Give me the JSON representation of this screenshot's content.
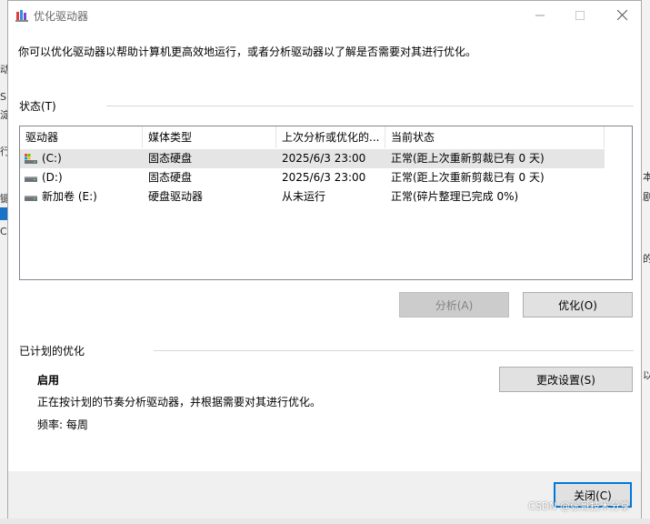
{
  "window": {
    "title": "优化驱动器"
  },
  "description": "你可以优化驱动器以帮助计算机更高效地运行，或者分析驱动器以了解是否需要对其进行优化。",
  "status": {
    "label": "状态(T)"
  },
  "table": {
    "columns": [
      "驱动器",
      "媒体类型",
      "上次分析或优化的...",
      "当前状态"
    ],
    "rows": [
      {
        "drive": "(C:)",
        "media": "固态硬盘",
        "last": "2025/6/3 23:00",
        "state": "正常(距上次重新剪裁已有 0 天)",
        "icon": "system-drive-icon"
      },
      {
        "drive": "(D:)",
        "media": "固态硬盘",
        "last": "2025/6/3 23:00",
        "state": "正常(距上次重新剪裁已有 0 天)",
        "icon": "drive-icon"
      },
      {
        "drive": "新加卷 (E:)",
        "media": "硬盘驱动器",
        "last": "从未运行",
        "state": "正常(碎片整理已完成 0%)",
        "icon": "drive-icon"
      }
    ]
  },
  "buttons": {
    "analyze": "分析(A)",
    "optimize": "优化(O)",
    "change_settings": "更改设置(S)",
    "close": "关闭(C)"
  },
  "scheduled": {
    "label": "已计划的优化",
    "enabled": "启用",
    "info": "正在按计划的节奏分析驱动器，并根据需要对其进行优化。",
    "frequency": "频率: 每周"
  },
  "watermark": "CSDN @张哥技术分享",
  "background_fragments": {
    "left": [
      "动",
      "S",
      "淀",
      "行",
      "键",
      "C"
    ],
    "right": [
      "本",
      "剧",
      "的",
      "以"
    ]
  },
  "colors": {
    "accent": "#0078d7",
    "selected_row": "#e5e5e5",
    "footer": "#f0f0f0"
  }
}
